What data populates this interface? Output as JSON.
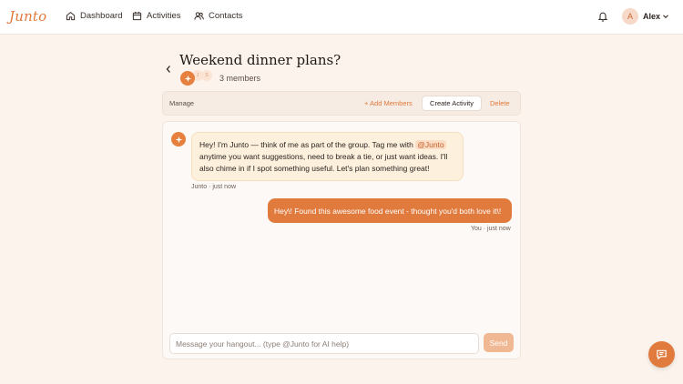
{
  "app": {
    "brand": "Junto"
  },
  "nav": {
    "items": [
      {
        "label": "Dashboard",
        "icon": "home-icon"
      },
      {
        "label": "Activities",
        "icon": "calendar-icon"
      },
      {
        "label": "Contacts",
        "icon": "users-icon"
      }
    ]
  },
  "user": {
    "initial": "A",
    "name": "Alex"
  },
  "group": {
    "title": "Weekend dinner plans?",
    "member_initials": [
      "",
      "J",
      "S"
    ],
    "members_text": "3 members"
  },
  "manage_bar": {
    "label": "Manage",
    "add_members": "+ Add Members",
    "create_activity": "Create Activity",
    "delete": "Delete"
  },
  "messages": [
    {
      "sender": "Junto",
      "text_before": "Hey! I'm Junto — think of me as part of the group. Tag me with ",
      "mention": "@Junto",
      "text_after": " anytime you want suggestions, need to break a tie, or just want ideas. I'll also chime in if I spot something useful. Let's plan something great!",
      "meta": "Junto · just now"
    },
    {
      "sender": "You",
      "text": "Hey\\! Found this awesome food event - thought you'd both love it\\!",
      "meta": "You · just now"
    }
  ],
  "composer": {
    "placeholder": "Message your hangout... (type @Junto for AI help)",
    "value": "",
    "send_label": "Send"
  },
  "colors": {
    "accent": "#e07a3d",
    "background": "#fbf3ec",
    "bot_bubble": "#fdf1de"
  }
}
